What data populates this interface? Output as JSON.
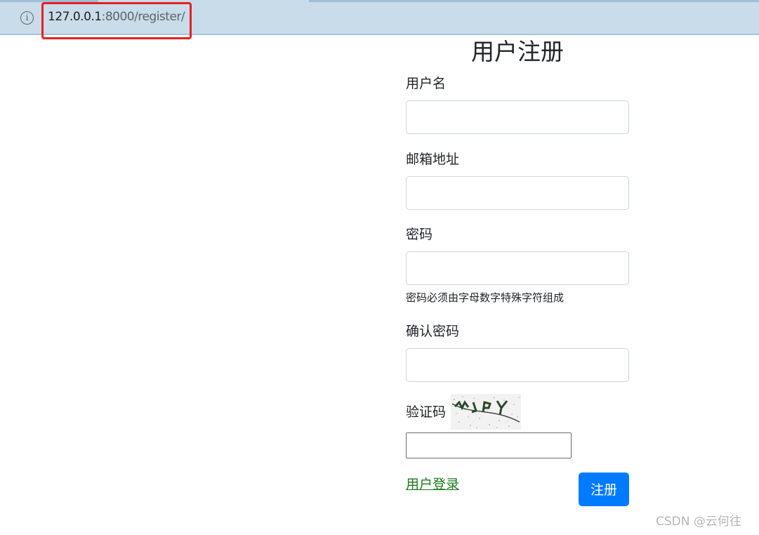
{
  "browser": {
    "url_host": "127.0.0.1",
    "url_path": ":8000/register/",
    "info_icon": "info-icon"
  },
  "form": {
    "title": "用户注册",
    "username_label": "用户名",
    "email_label": "邮箱地址",
    "password_label": "密码",
    "password_help": "密码必须由字母数字特殊字符组成",
    "confirm_label": "确认密码",
    "captcha_label": "验证码",
    "captcha_text": "MJPY",
    "login_link": "用户登录",
    "submit_label": "注册"
  },
  "watermark": "CSDN @云何往",
  "colors": {
    "primary_button": "#007bff",
    "link": "#1a7a1a",
    "highlight": "#e62020"
  }
}
